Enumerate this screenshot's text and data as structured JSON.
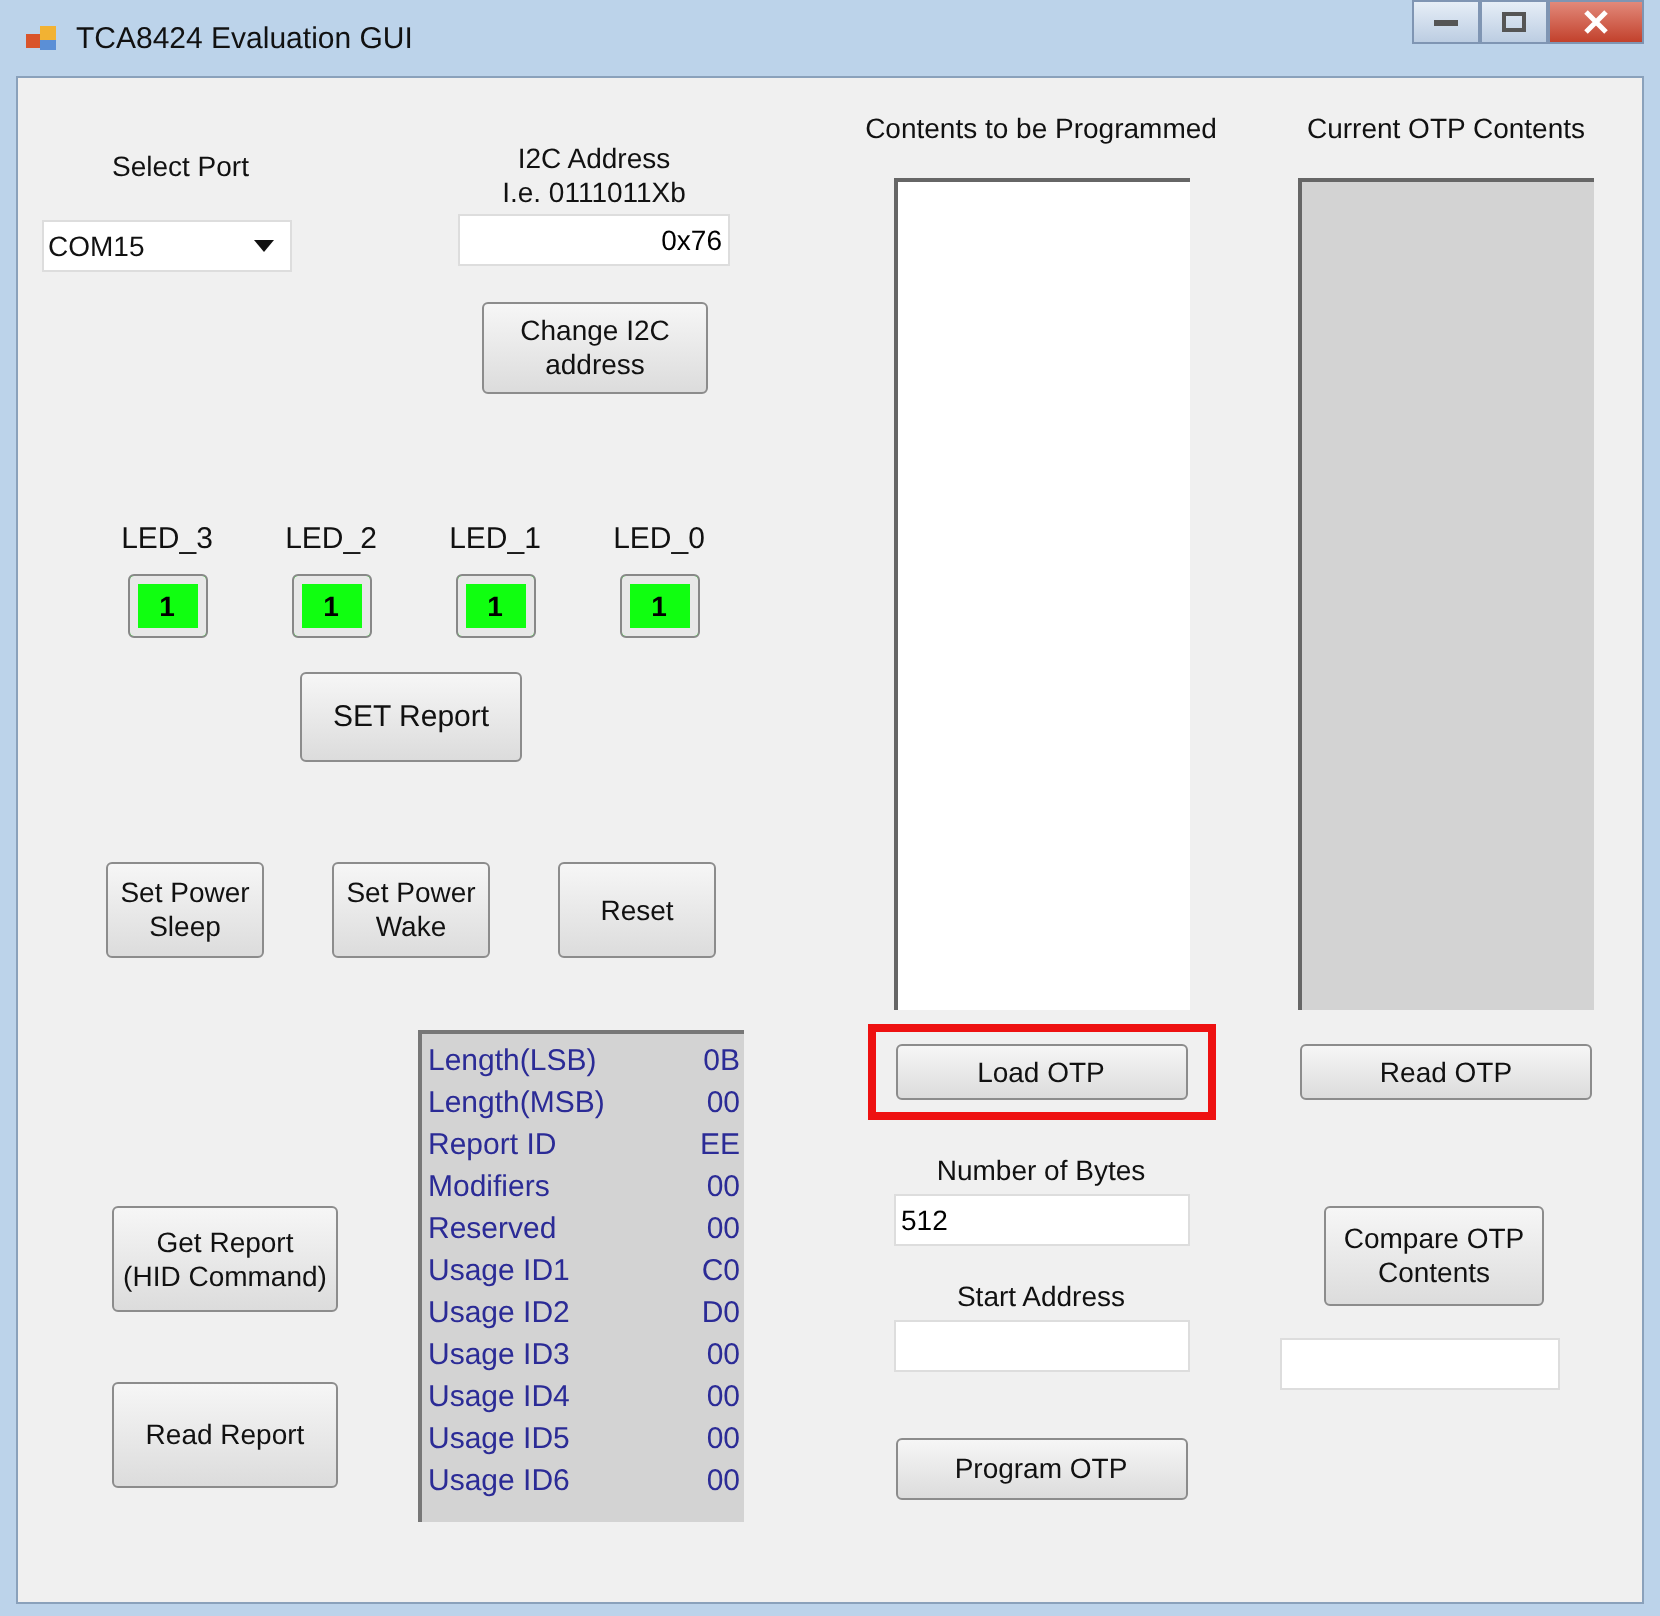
{
  "window": {
    "title": "TCA8424 Evaluation GUI"
  },
  "port": {
    "label": "Select Port",
    "value": "COM15"
  },
  "i2c": {
    "label_lines": [
      "I2C Address",
      "I.e. 0111011Xb"
    ],
    "value": "0x76",
    "button_lines": [
      "Change I2C",
      "address"
    ]
  },
  "leds": [
    {
      "label": "LED_3",
      "value": "1",
      "on": true
    },
    {
      "label": "LED_2",
      "value": "1",
      "on": true
    },
    {
      "label": "LED_1",
      "value": "1",
      "on": true
    },
    {
      "label": "LED_0",
      "value": "1",
      "on": true
    }
  ],
  "set_report_button": "SET Report",
  "power_buttons": [
    {
      "lines": [
        "Set Power",
        "Sleep"
      ]
    },
    {
      "lines": [
        "Set Power",
        "Wake"
      ]
    },
    {
      "lines": [
        "Reset"
      ]
    }
  ],
  "report_buttons": [
    {
      "lines": [
        "Get Report",
        "(HID Command)"
      ]
    },
    {
      "lines": [
        "Read Report"
      ]
    }
  ],
  "report": [
    {
      "field": "Length(LSB)",
      "value": "0B"
    },
    {
      "field": "Length(MSB)",
      "value": "00"
    },
    {
      "field": "Report ID",
      "value": "EE"
    },
    {
      "field": "Modifiers",
      "value": "00"
    },
    {
      "field": "Reserved",
      "value": "00"
    },
    {
      "field": "Usage ID1",
      "value": "C0"
    },
    {
      "field": "Usage ID2",
      "value": "D0"
    },
    {
      "field": "Usage ID3",
      "value": "00"
    },
    {
      "field": "Usage ID4",
      "value": "00"
    },
    {
      "field": "Usage ID5",
      "value": "00"
    },
    {
      "field": "Usage ID6",
      "value": "00"
    }
  ],
  "program": {
    "title": "Contents to be Programmed",
    "load_button": {
      "label": "Load OTP",
      "highlighted": true
    },
    "bytes_label": "Number of Bytes",
    "bytes_value": "512",
    "start_label": "Start Address",
    "program_button": "Program OTP"
  },
  "current": {
    "title": "Current OTP Contents",
    "read_button": "Read OTP",
    "compare_button_lines": [
      "Compare OTP",
      "Contents"
    ]
  }
}
